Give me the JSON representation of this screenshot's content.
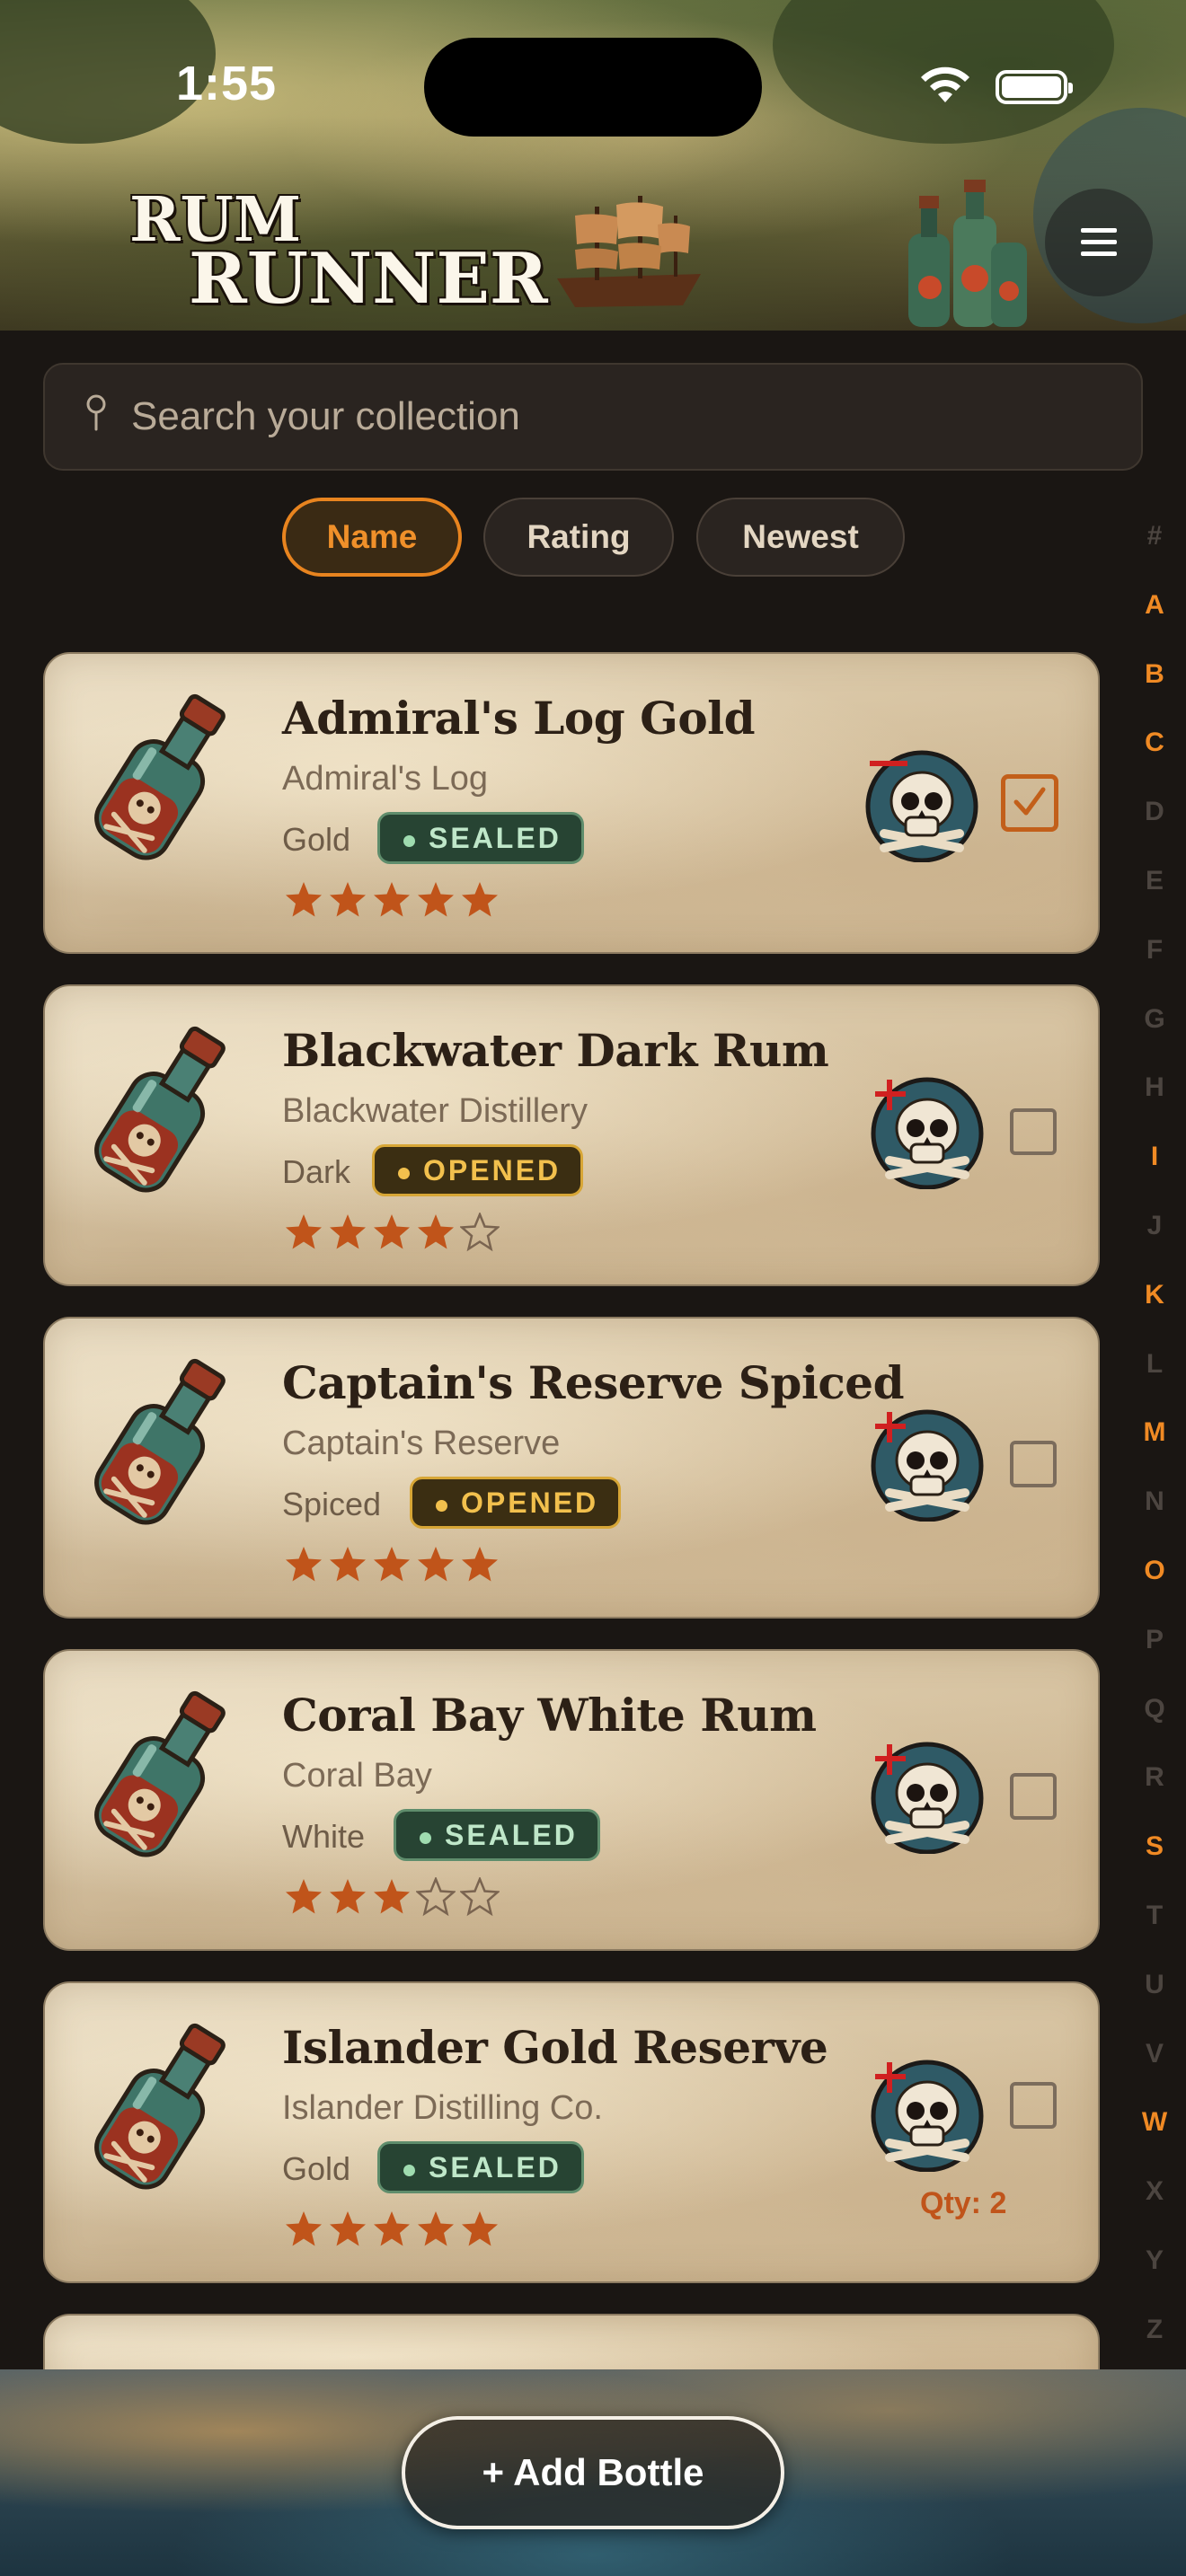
{
  "status_bar": {
    "time": "1:55"
  },
  "header": {
    "logo_line1": "RUM",
    "logo_line2": "RUNNER",
    "menu_icon": "hamburger-icon"
  },
  "search": {
    "placeholder": "Search your collection",
    "value": ""
  },
  "sort": {
    "options": [
      "Name",
      "Rating",
      "Newest"
    ],
    "selected": "Name"
  },
  "index_letters": [
    "#",
    "A",
    "B",
    "C",
    "D",
    "E",
    "F",
    "G",
    "H",
    "I",
    "J",
    "K",
    "L",
    "M",
    "N",
    "O",
    "P",
    "Q",
    "R",
    "S",
    "T",
    "U",
    "V",
    "W",
    "X",
    "Y",
    "Z"
  ],
  "index_active": [
    "A",
    "B",
    "C",
    "I",
    "K",
    "M",
    "O",
    "S",
    "W"
  ],
  "bottles": [
    {
      "name": "Admiral's Log Gold",
      "producer": "Admiral's Log",
      "type": "Gold",
      "status": "SEALED",
      "rating": 5,
      "selected": true,
      "qty": ""
    },
    {
      "name": "Blackwater Dark Rum",
      "producer": "Blackwater Distillery",
      "type": "Dark",
      "status": "OPENED",
      "rating": 4,
      "selected": false,
      "qty": ""
    },
    {
      "name": "Captain's Reserve Spiced",
      "producer": "Captain's Reserve",
      "type": "Spiced",
      "status": "OPENED",
      "rating": 5,
      "selected": false,
      "qty": ""
    },
    {
      "name": "Coral Bay White Rum",
      "producer": "Coral Bay",
      "type": "White",
      "status": "SEALED",
      "rating": 3,
      "selected": false,
      "qty": ""
    },
    {
      "name": "Islander Gold Reserve",
      "producer": "Islander Distilling Co.",
      "type": "Gold",
      "status": "SEALED",
      "rating": 5,
      "selected": false,
      "qty": "Qty: 2"
    }
  ],
  "colors": {
    "accent": "#f08a24",
    "sealed": "#274433",
    "opened": "#3b2e12",
    "star": "#c0541a"
  },
  "add_button": {
    "label": "+ Add Bottle"
  }
}
